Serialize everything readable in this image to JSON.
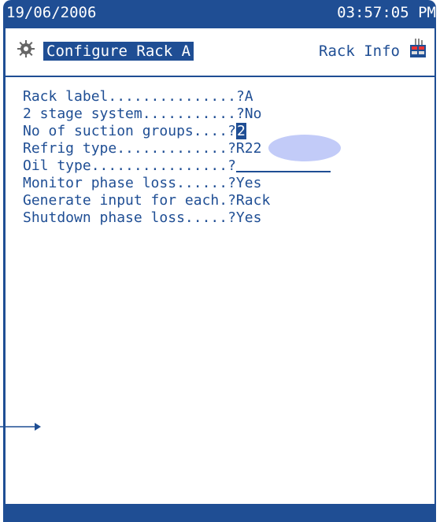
{
  "status": {
    "date": "19/06/2006",
    "time": "03:57:05 PM"
  },
  "header": {
    "title": "Configure Rack A",
    "info": "Rack Info"
  },
  "fields": [
    {
      "label": "Rack label...............",
      "value": "?A"
    },
    {
      "label": "2 stage system...........",
      "value": "?No"
    },
    {
      "label": "No of suction groups....",
      "value_prefix": "?",
      "cursor_value": "2"
    },
    {
      "label": "Refrig type.............",
      "value": "?R22"
    },
    {
      "label": "Oil type................",
      "value_prefix": "?",
      "blank": true
    },
    {
      "label": "Monitor phase loss......",
      "value": "?Yes"
    },
    {
      "label": "Generate input for each.",
      "value": "?Rack"
    },
    {
      "label": "Shutdown phase loss.....",
      "value": "?Yes"
    }
  ],
  "colors": {
    "screen_blue": "#1f4e94",
    "highlight": "#7888f0"
  },
  "icons": {
    "left": "gear-icon",
    "right": "rack-info-icon"
  }
}
